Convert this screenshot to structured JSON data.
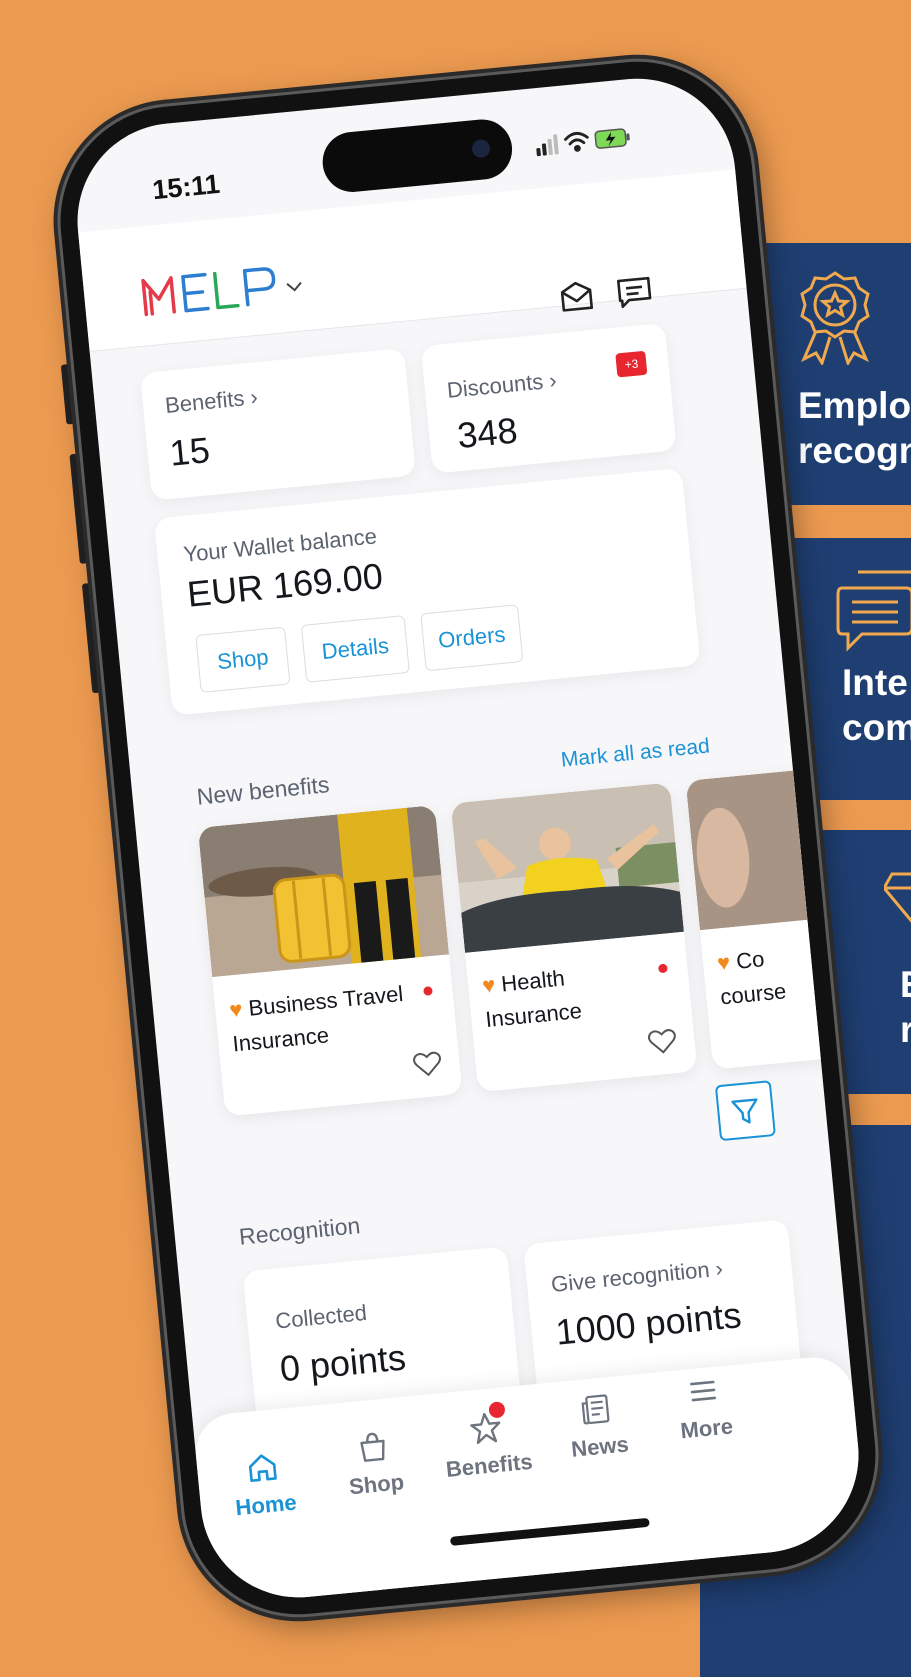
{
  "status": {
    "time": "15:11"
  },
  "header": {
    "logo": "MELP"
  },
  "stats": {
    "benefits_label": "Benefits",
    "benefits_count": "15",
    "discounts_label": "Discounts",
    "discounts_count": "348",
    "discounts_badge": "+3"
  },
  "wallet": {
    "label": "Your Wallet balance",
    "balance": "EUR 169.00",
    "buttons": [
      "Shop",
      "Details",
      "Orders"
    ]
  },
  "new_benefits": {
    "title": "New benefits",
    "mark_all": "Mark all as read",
    "items": [
      {
        "title": "Business Travel Insurance"
      },
      {
        "title": "Health Insurance"
      },
      {
        "title": "Co course"
      }
    ]
  },
  "recognition": {
    "title": "Recognition",
    "collected_label": "Collected",
    "collected_value": "0 points",
    "give_label": "Give recognition",
    "give_value": "1000 points"
  },
  "nav": {
    "items": [
      {
        "label": "Home",
        "icon": "home-icon",
        "active": true
      },
      {
        "label": "Shop",
        "icon": "shop-icon"
      },
      {
        "label": "Benefits",
        "icon": "star-icon"
      },
      {
        "label": "News",
        "icon": "news-icon"
      },
      {
        "label": "More",
        "icon": "menu-icon"
      }
    ]
  },
  "panels": [
    {
      "text": "Emplo\nrecogn",
      "icon": "award-badge-icon"
    },
    {
      "text": "Inte\ncom",
      "icon": "chat-bubbles-icon"
    },
    {
      "text": "E\nr",
      "icon": "diamond-icon"
    }
  ],
  "colors": {
    "background": "#ec9a50",
    "panel": "#1f3f73",
    "accent": "#1a93d6",
    "badge": "#e8262f"
  }
}
